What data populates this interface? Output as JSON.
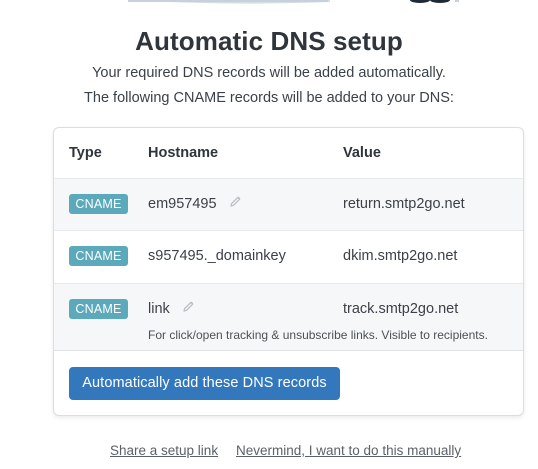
{
  "header": {
    "title": "Automatic DNS setup",
    "subtitle_1": "Your required DNS records will be added automatically.",
    "subtitle_2": "The following CNAME records will be added to your DNS:"
  },
  "table": {
    "columns": [
      "Type",
      "Hostname",
      "Value"
    ],
    "rows": [
      {
        "type": "CNAME",
        "hostname": "em957495",
        "value": "return.smtp2go.net",
        "editable": true,
        "note": ""
      },
      {
        "type": "CNAME",
        "hostname": "s957495._domainkey",
        "value": "dkim.smtp2go.net",
        "editable": false,
        "note": ""
      },
      {
        "type": "CNAME",
        "hostname": "link",
        "value": "track.smtp2go.net",
        "editable": true,
        "note": "For click/open tracking & unsubscribe links. Visible to recipients."
      }
    ]
  },
  "actions": {
    "primary_label": "Automatically add these DNS records",
    "share_link": "Share a setup link",
    "manual_link": "Nevermind, I want to do this manually"
  },
  "colors": {
    "badge": "#5ba9ba",
    "primary_button": "#3378bd",
    "row_alt": "#f6f7f9"
  },
  "icons": {
    "edit": "pencil-icon"
  }
}
